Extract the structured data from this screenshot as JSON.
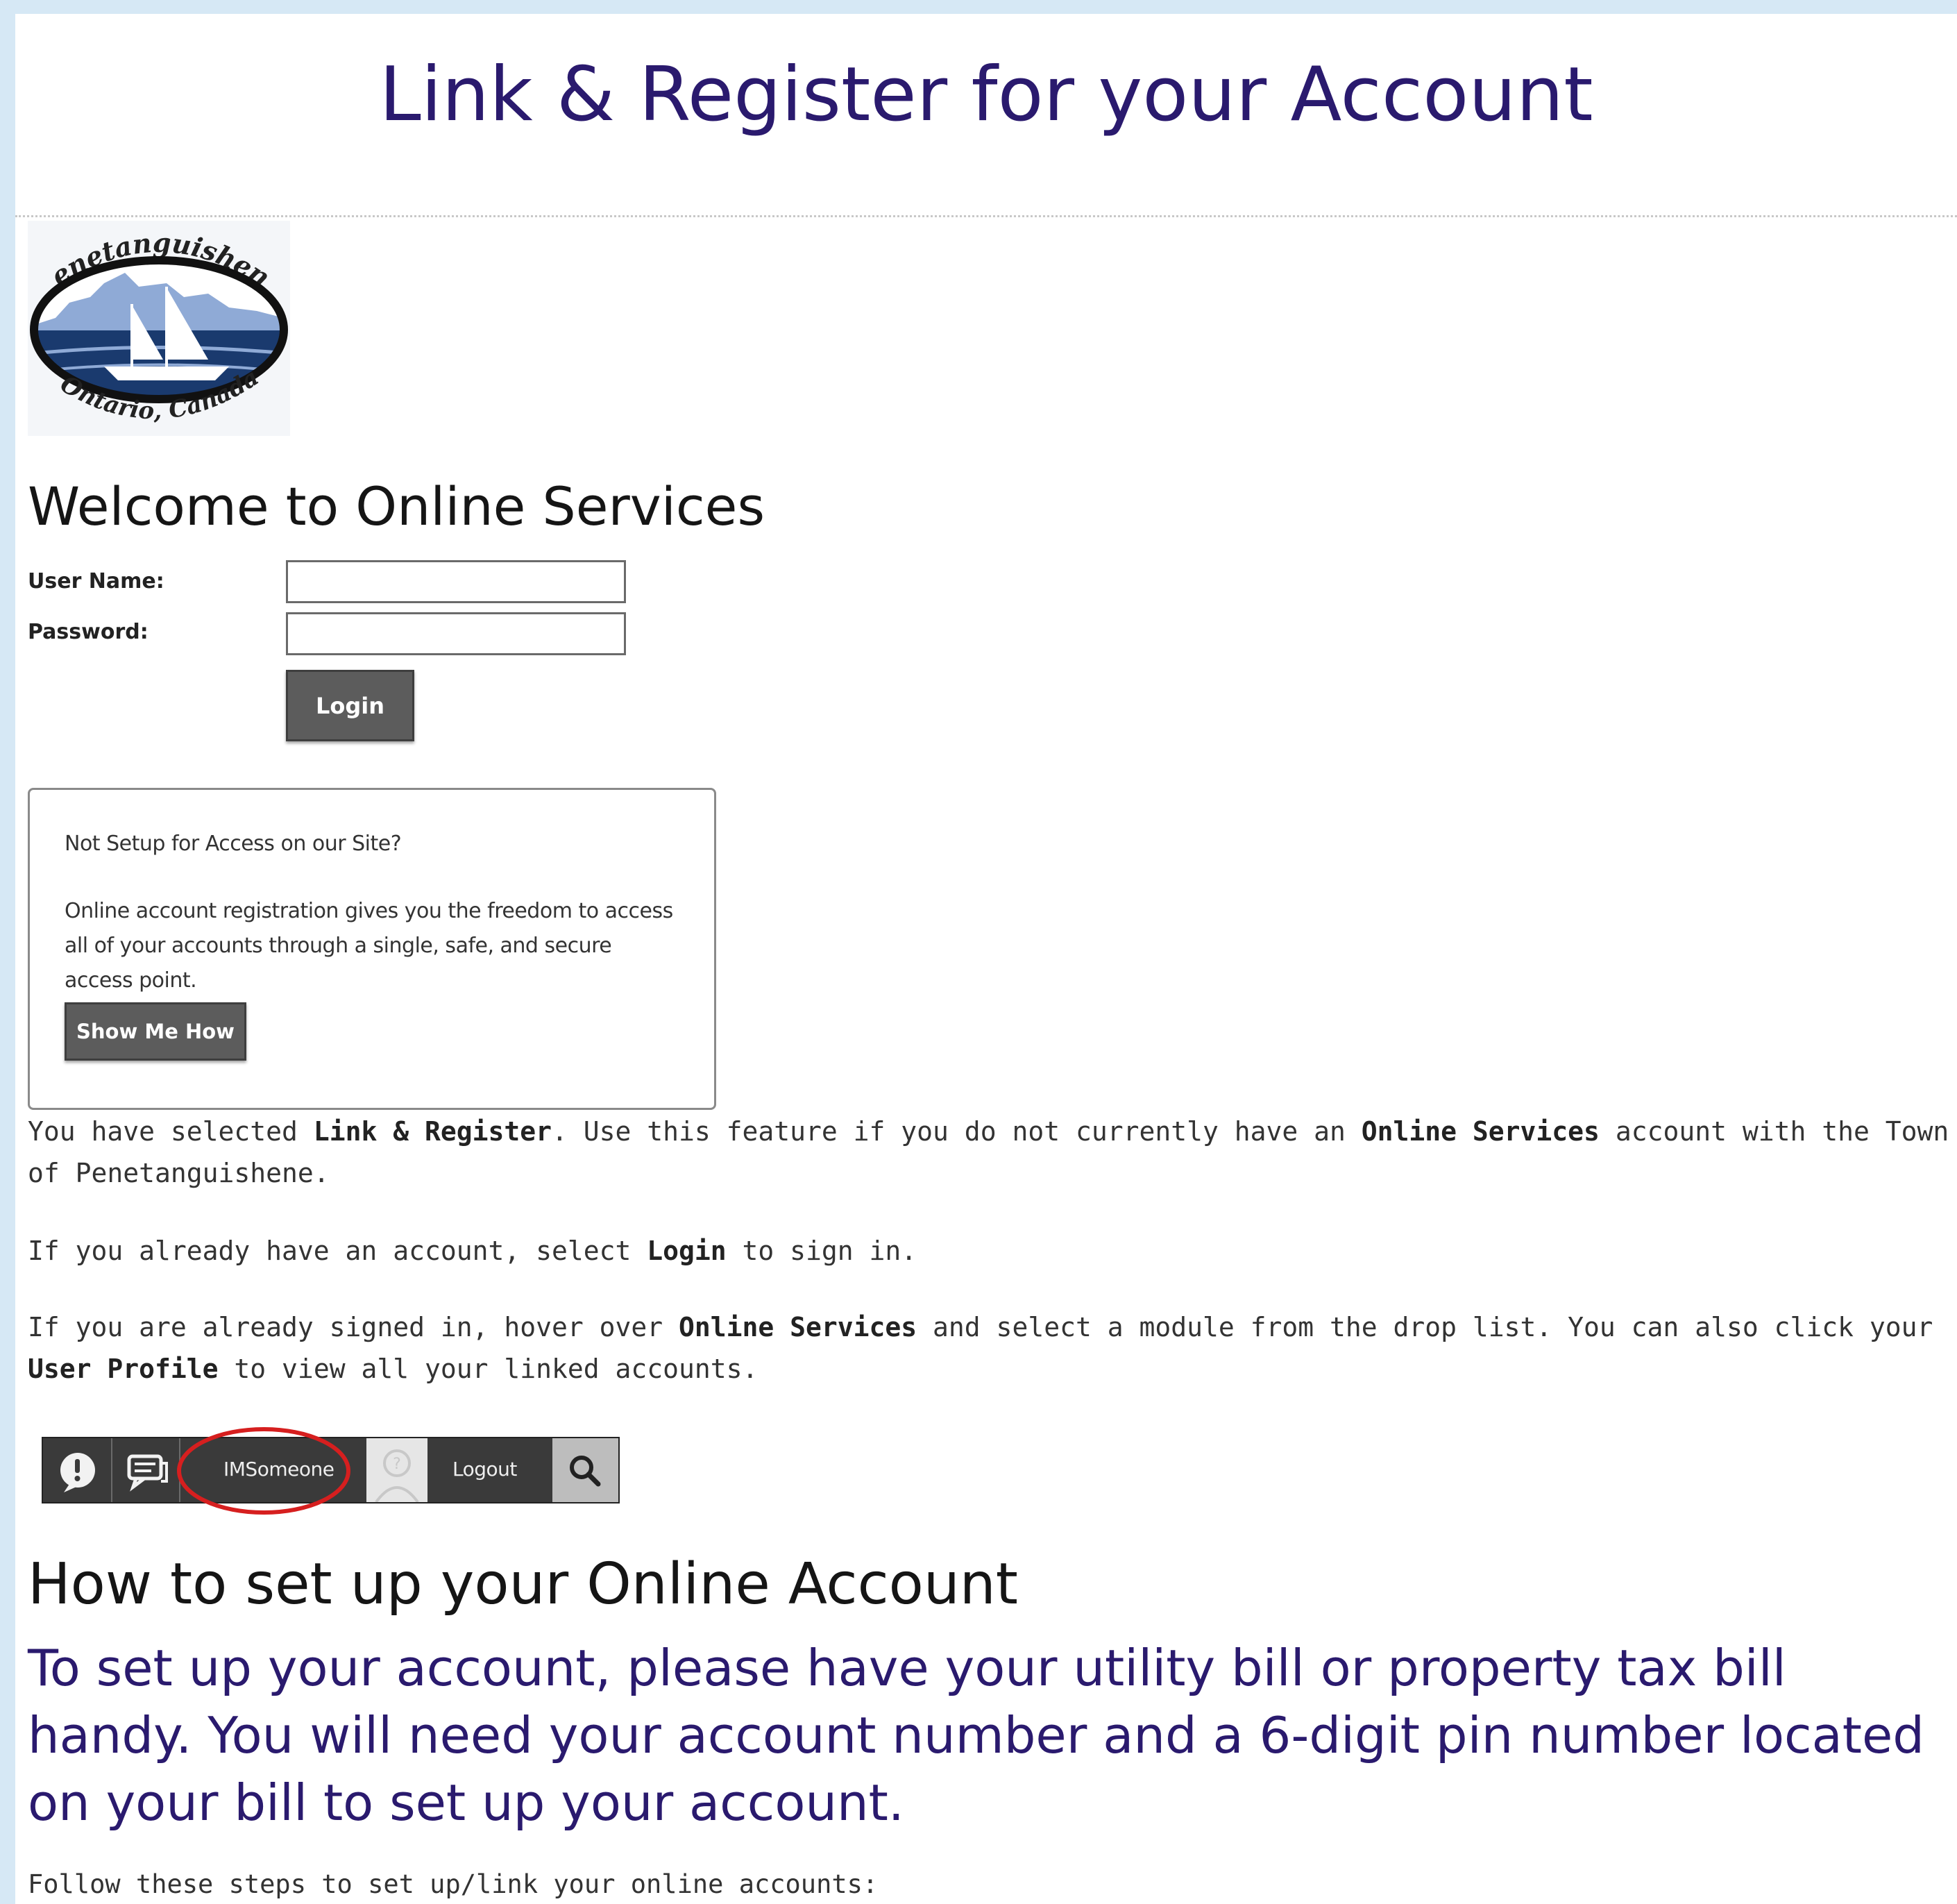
{
  "page": {
    "title": "Link & Register for your Account"
  },
  "logo": {
    "top_text": "Penetanguishene",
    "bottom_text": "Ontario, Canada",
    "colors": {
      "navy": "#1a3a6e",
      "sky": "#8faad6",
      "frame": "#111111"
    }
  },
  "login": {
    "heading": "Welcome to Online Services",
    "username_label": "User Name:",
    "username_value": "",
    "password_label": "Password:",
    "password_value": "",
    "login_button": "Login"
  },
  "register_box": {
    "question": "Not Setup for Access on our Site?",
    "description": "Online account registration gives you the freedom to access all of your accounts through a single, safe, and secure access point.",
    "button": "Show Me How"
  },
  "info": {
    "p1_pre": "You have selected ",
    "p1_b1": "Link & Register",
    "p1_mid": ".  Use this feature if you do not currently have an ",
    "p1_b2": "Online Services",
    "p1_post": " account with the Town of Penetanguishene.",
    "p2_pre": "If you already have an account, select ",
    "p2_b1": "Login",
    "p2_post": " to sign in.",
    "p3_pre": "If you are already signed in, hover over ",
    "p3_b1": "Online Services",
    "p3_mid": " and select a module from the drop list.  You can also click your ",
    "p3_b2": "User Profile",
    "p3_post": " to view all your linked accounts."
  },
  "toolbar_example": {
    "icons": [
      "alert-icon",
      "chat-icon",
      "avatar-icon",
      "search-icon"
    ],
    "username": "IMSomeone",
    "logout": "Logout",
    "highlight_color": "#d61f1f"
  },
  "setup": {
    "heading": "How to set up your Online Account",
    "intro": "To set up your account, please have your utility bill or property tax bill handy. You will need your account number and a 6-digit pin number located on your bill to set up your account.",
    "steps_intro": "Follow these steps to set up/link your online accounts:"
  }
}
